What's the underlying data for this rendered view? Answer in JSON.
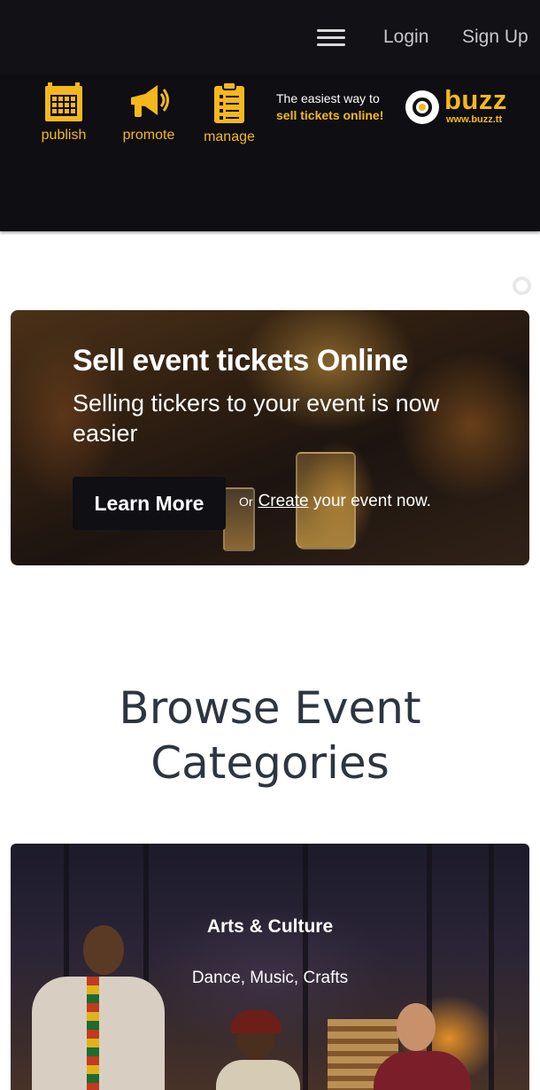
{
  "nav": {
    "menu_icon": "hamburger-menu-icon",
    "login": "Login",
    "signup": "Sign Up"
  },
  "promo": {
    "items": [
      {
        "label": "publish",
        "icon": "calendar-icon"
      },
      {
        "label": "promote",
        "icon": "megaphone-icon"
      },
      {
        "label": "manage",
        "icon": "clipboard-icon"
      }
    ],
    "tagline_line1": "The easiest way to",
    "tagline_line2": "sell tickets online!",
    "brand": "buzz",
    "brand_url": "www.buzz.tt",
    "accent_color": "#f5b81c"
  },
  "hero": {
    "title": "Sell event tickets Online",
    "subtitle": "Selling tickers to your event is now easier",
    "learn_more": "Learn More",
    "or": "Or",
    "create_link": "Create",
    "create_suffix": "your event now."
  },
  "browse": {
    "title_line1": "Browse Event",
    "title_line2": "Categories"
  },
  "category": {
    "title": "Arts & Culture",
    "subtitle": "Dance, Music, Crafts"
  }
}
